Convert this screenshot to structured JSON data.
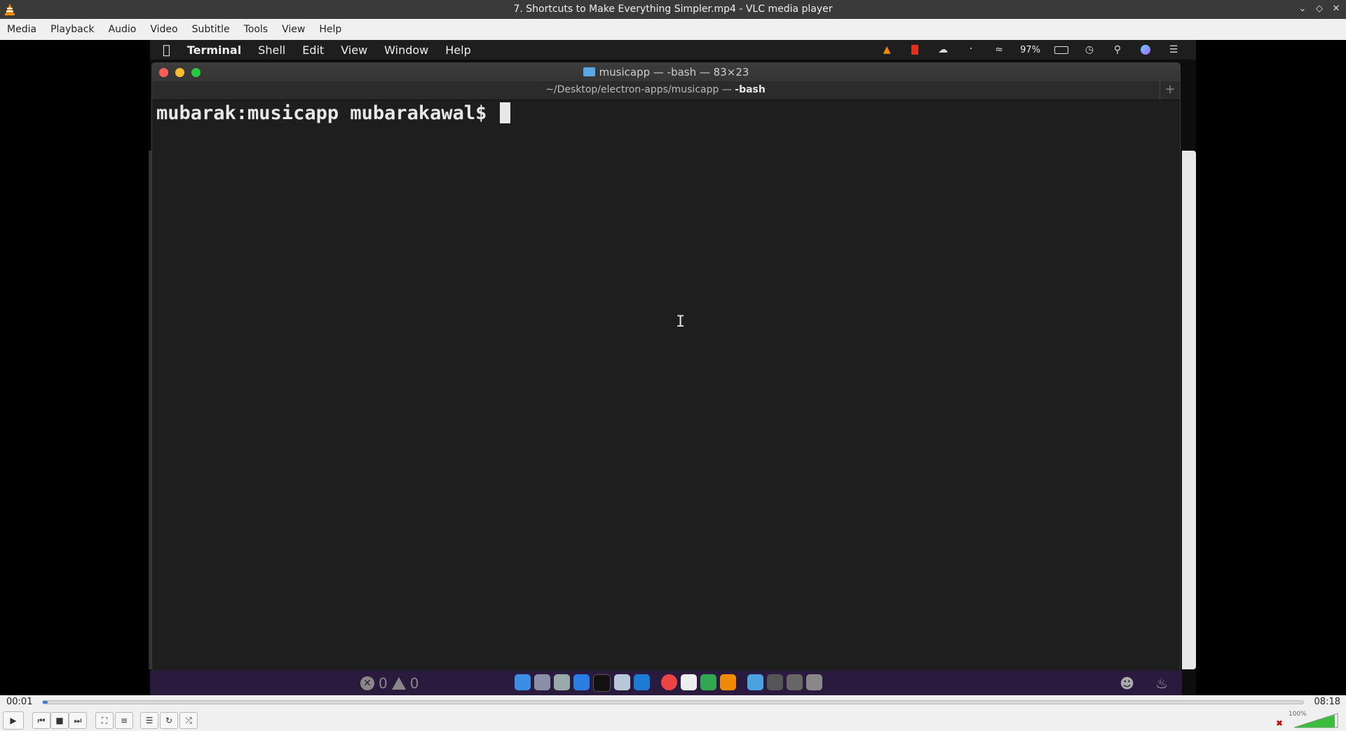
{
  "window": {
    "title": "7. Shortcuts to Make Everything Simpler.mp4 - VLC media player",
    "controls": [
      "minimize",
      "maximize",
      "close"
    ]
  },
  "menubar": {
    "items": [
      "Media",
      "Playback",
      "Audio",
      "Video",
      "Subtitle",
      "Tools",
      "View",
      "Help"
    ]
  },
  "video": {
    "mac_menubar": {
      "app": "Terminal",
      "items": [
        "Shell",
        "Edit",
        "View",
        "Window",
        "Help"
      ],
      "battery": "97%",
      "status_icons": [
        "vlc-icon",
        "record-icon",
        "cloud-icon",
        "bluetooth-icon",
        "wifi-icon",
        "battery-icon",
        "clock-icon",
        "search-icon",
        "siri-icon",
        "list-icon"
      ]
    },
    "terminal": {
      "window_title": "musicapp — -bash — 83×23",
      "tab_path": "~/Desktop/electron-apps/musicapp — ",
      "tab_shell": "-bash",
      "prompt": "mubarak:musicapp mubarakawal$ "
    },
    "dock": {
      "errors": "0",
      "warnings": "0"
    }
  },
  "player": {
    "elapsed": "00:01",
    "total": "08:18",
    "progress": 0.002,
    "volume": "100%",
    "colors": {
      "accent": "#3a7fd5",
      "dock": "#2a1a3e"
    }
  }
}
